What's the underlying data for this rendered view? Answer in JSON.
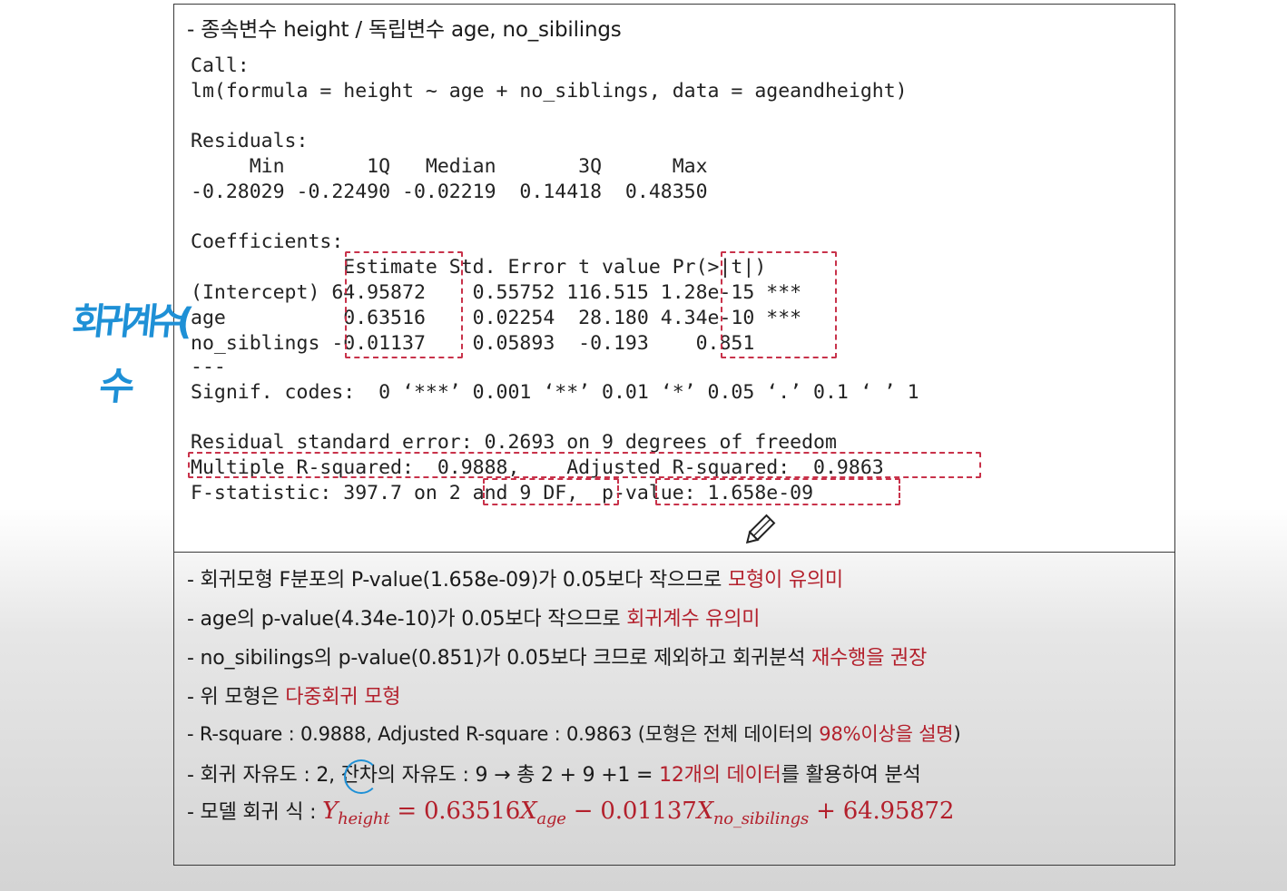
{
  "heading": "- 종속변수 height / 독립변수 age, no_sibilings",
  "r_output": {
    "call_label": "Call:",
    "call_formula": "lm(formula = height ~ age + no_siblings, data = ageandheight)",
    "residuals_label": "Residuals:",
    "residuals_header": "     Min       1Q   Median       3Q      Max",
    "residuals_values": "-0.28029 -0.22490 -0.02219  0.14418  0.48350",
    "coefficients_label": "Coefficients:",
    "coef_header": "             Estimate Std. Error t value Pr(>|t|)",
    "coef_rows": [
      "(Intercept) 64.95872    0.55752 116.515 1.28e-15 ***",
      "age          0.63516    0.02254  28.180 4.34e-10 ***",
      "no_siblings -0.01137    0.05893  -0.193    0.851"
    ],
    "separator": "---",
    "signif_codes": "Signif. codes:  0 ‘***’ 0.001 ‘**’ 0.01 ‘*’ 0.05 ‘.’ 0.1 ‘ ’ 1",
    "rse": "Residual standard error: 0.2693 on 9 degrees of freedom",
    "r_squared": "Multiple R-squared:  0.9888,    Adjusted R-squared:  0.9863",
    "f_statistic": "F-statistic: 397.7 on 2 and 9 DF,  p-value: 1.658e-09"
  },
  "annotations": {
    "handwriting_line1": "회귀계수(",
    "handwriting_line2": "수"
  },
  "notes": [
    {
      "plain": "- 회귀모형 F분포의 P-value(1.658e-09)가 0.05보다 작으므로 ",
      "red": "모형이 유의미",
      "tail": ""
    },
    {
      "plain": "- age의 p-value(4.34e-10)가 0.05보다 작으므로 ",
      "red": "회귀계수 유의미",
      "tail": ""
    },
    {
      "plain": "- no_sibilings의 p-value(0.851)가 0.05보다 크므로 제외하고 회귀분석 ",
      "red": "재수행을 권장",
      "tail": ""
    },
    {
      "plain": "- 위 모형은 ",
      "red": "다중회귀 모형",
      "tail": ""
    },
    {
      "plain": "- R-square : 0.9888, Adjusted R-square : 0.9863 (모형은 전체 데이터의 ",
      "red": "98%이상을 설명",
      "tail": ")"
    },
    {
      "plain": "- 회귀 자유도 : 2, 잔차의 자유도 : 9 → 총 2 + 9 +1 = ",
      "red": "12개의 데이터",
      "tail": "를 활용하여 분석"
    }
  ],
  "model_equation": {
    "prefix": "- 모델 회귀 식 : ",
    "y": "Y",
    "y_sub": "height",
    "eq1": " = 0.63516",
    "x1": "X",
    "x1_sub": "age",
    "eq2": " − 0.01137",
    "x2": "X",
    "x2_sub": "no_sibilings",
    "eq3": " + 64.95872"
  },
  "colors": {
    "highlight_red": "#b3202c",
    "dashed_box": "#c8324a",
    "handwriting_blue": "#1e90d6"
  }
}
